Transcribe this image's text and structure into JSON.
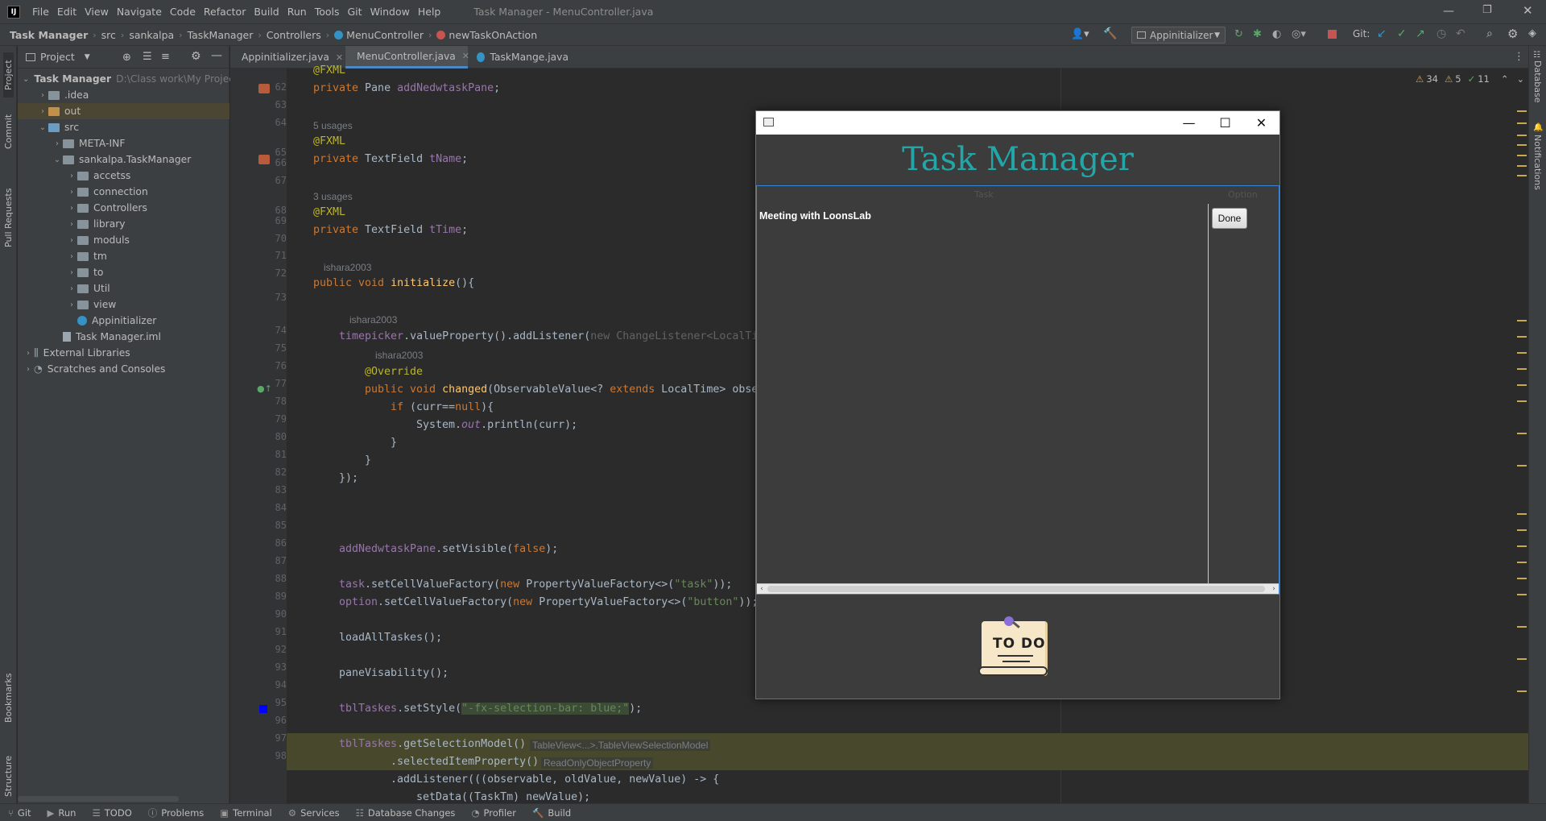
{
  "menubar": {
    "items": [
      "File",
      "Edit",
      "View",
      "Navigate",
      "Code",
      "Refactor",
      "Build",
      "Run",
      "Tools",
      "Git",
      "Window",
      "Help"
    ],
    "window_title": "Task Manager - MenuController.java"
  },
  "breadcrumb": [
    "Task Manager",
    "src",
    "sankalpa",
    "TaskManager",
    "Controllers",
    "MenuController",
    "newTaskOnAction"
  ],
  "toolbar": {
    "run_config": "Appinitializer",
    "git_label": "Git:"
  },
  "left_tool_tabs": [
    "Project",
    "Commit",
    "Pull Requests",
    "Bookmarks",
    "Structure"
  ],
  "right_tool_tabs": [
    "Database",
    "Notifications"
  ],
  "project_panel": {
    "title": "Project",
    "tree": [
      {
        "label": "Task Manager",
        "path": "D:\\Class work\\My Projects",
        "depth": 0,
        "kind": "module",
        "open": true
      },
      {
        "label": ".idea",
        "depth": 1,
        "kind": "folder",
        "open": false
      },
      {
        "label": "out",
        "depth": 1,
        "kind": "folder-orange",
        "open": false,
        "selected": true
      },
      {
        "label": "src",
        "depth": 1,
        "kind": "folder-blue",
        "open": true
      },
      {
        "label": "META-INF",
        "depth": 2,
        "kind": "folder",
        "open": false
      },
      {
        "label": "sankalpa.TaskManager",
        "depth": 2,
        "kind": "folder",
        "open": true
      },
      {
        "label": "accetss",
        "depth": 3,
        "kind": "folder",
        "open": false
      },
      {
        "label": "connection",
        "depth": 3,
        "kind": "folder",
        "open": false
      },
      {
        "label": "Controllers",
        "depth": 3,
        "kind": "folder",
        "open": false
      },
      {
        "label": "library",
        "depth": 3,
        "kind": "folder",
        "open": false
      },
      {
        "label": "moduls",
        "depth": 3,
        "kind": "folder",
        "open": false
      },
      {
        "label": "tm",
        "depth": 3,
        "kind": "folder",
        "open": false
      },
      {
        "label": "to",
        "depth": 3,
        "kind": "folder",
        "open": false
      },
      {
        "label": "Util",
        "depth": 3,
        "kind": "folder",
        "open": false
      },
      {
        "label": "view",
        "depth": 3,
        "kind": "folder",
        "open": false
      },
      {
        "label": "Appinitializer",
        "depth": 3,
        "kind": "class"
      },
      {
        "label": "Task Manager.iml",
        "depth": 2,
        "kind": "file"
      },
      {
        "label": "External Libraries",
        "depth": 0,
        "kind": "lib",
        "open": false
      },
      {
        "label": "Scratches and Consoles",
        "depth": 0,
        "kind": "scratch",
        "open": false
      }
    ]
  },
  "editor_tabs": [
    {
      "label": "Appinitializer.java",
      "active": false
    },
    {
      "label": "MenuController.java",
      "active": true
    },
    {
      "label": "TaskMange.java",
      "active": false
    }
  ],
  "inspections": {
    "warnings": "34",
    "weak": "5",
    "ok": "11"
  },
  "line_numbers": [
    "62",
    "63",
    "64",
    "65",
    "66",
    "67",
    "68",
    "69",
    "70",
    "71",
    "72",
    "73",
    "74",
    "75",
    "76",
    "77",
    "78",
    "79",
    "80",
    "81",
    "82",
    "83",
    "84",
    "85",
    "86",
    "87",
    "88",
    "89",
    "90",
    "91",
    "92",
    "93",
    "94",
    "95",
    "96",
    "97",
    "98"
  ],
  "code": {
    "l62": "@FXML",
    "l63a": "private ",
    "l63b": "Pane ",
    "l63c": "addNedwtaskPane",
    "u65": "5 usages",
    "l65": "@FXML",
    "l66a": "private ",
    "l66b": "TextField ",
    "l66c": "tName",
    "u68": "3 usages",
    "l68": "@FXML",
    "l69a": "private ",
    "l69b": "TextField ",
    "l69c": "tTime",
    "a71": "ishara2003",
    "l71a": "public void ",
    "l71b": "initialize",
    "l71c": "(){",
    "a73": "ishara2003",
    "l73a": "timepicker",
    "l73b": ".valueProperty().addListener(",
    "l73c": "new ChangeListener<LocalTi",
    "a74": "ishara2003",
    "l74": "@Override",
    "l75a": "public void ",
    "l75b": "changed",
    "l75c": "(ObservableValue<? ",
    "l75d": "extends ",
    "l75e": "LocalTime> obse",
    "l76a": "if ",
    "l76b": "(curr==",
    "l76c": "null",
    "l76d": "){",
    "l77a": "System.",
    "l77b": "out",
    "l77c": ".println(curr);",
    "l78": "}",
    "l79": "}",
    "l80": "});",
    "l84a": "addNedwtaskPane",
    "l84b": ".setVisible(",
    "l84c": "false",
    "l84d": ");",
    "l86a": "task",
    "l86b": ".setCellValueFactory(",
    "l86c": "new ",
    "l86d": "PropertyValueFactory<>(",
    "l86e": "\"task\"",
    "l86f": "));",
    "l87a": "option",
    "l87b": ".setCellValueFactory(",
    "l87c": "new ",
    "l87d": "PropertyValueFactory<>(",
    "l87e": "\"button\"",
    "l87f": "));",
    "l89": "loadAllTaskes();",
    "l91": "paneVisability();",
    "l93a": "tblTaskes",
    "l93b": ".setStyle(",
    "l93c": "\"-fx-selection-bar: blue;\"",
    "l93d": ");",
    "l95a": "tblTaskes",
    "l95b": ".getSelectionModel()",
    "h95": "TableView<...>.TableViewSelectionModel",
    "l96": ".selectedItemProperty()",
    "h96": "ReadOnlyObjectProperty",
    "l97a": ".addListener",
    "l97b": "(((observable, oldValue, newValue) -> {",
    "l98": "setData((TaskTm) newValue);"
  },
  "fx_window": {
    "header": "Task Manager",
    "table": {
      "columns": [
        "Task",
        "Option"
      ],
      "rows": [
        {
          "task": "Meeting with LoonsLab",
          "option": "Done"
        }
      ]
    },
    "todo_label": "TO DO"
  },
  "statusbar": [
    "Git",
    "Run",
    "TODO",
    "Problems",
    "Terminal",
    "Services",
    "Database Changes",
    "Profiler",
    "Build"
  ],
  "colors": {
    "accent": "#4a88c7",
    "fx_title": "#22a6a8",
    "highlight": "#48482d"
  }
}
